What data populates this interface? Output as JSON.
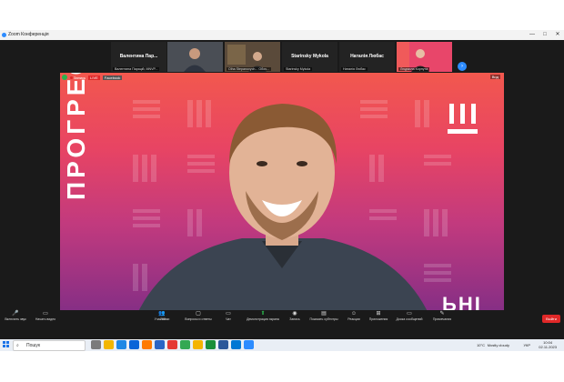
{
  "window": {
    "title": "Zoom Конференція",
    "controls": [
      "—",
      "□",
      "✕"
    ]
  },
  "participants": [
    {
      "big_name": "Валентина Пар...",
      "small_name": "Валентина Парацій, MNVP..."
    },
    {
      "big_name": "",
      "small_name": ""
    },
    {
      "big_name": "",
      "small_name": "Olha Stepanovych... Обоч..."
    },
    {
      "big_name": "Starinsky Mykola",
      "small_name": "Starinsky Mykola"
    },
    {
      "big_name": "Наталія Любас",
      "small_name": "Наталія Любас"
    },
    {
      "big_name": "",
      "small_name": "Людмила Корнута"
    }
  ],
  "main_video": {
    "speaker": "Dmytro Chumachenko",
    "vertical_text": "ПРОГРЕСИВНІ",
    "bottom_text": "ЬНІ",
    "rec_label": "Запись",
    "live_label": "LIVE",
    "stream_target": "Facebook",
    "view_label": "Вид"
  },
  "toolbar": {
    "audio": "Включить звук",
    "video": "Начать видео",
    "participants": "Участники",
    "participants_count": "260",
    "qa": "Вопросы и ответы",
    "chat": "Чат",
    "share": "Демонстрация экрана",
    "record": "Запись",
    "captions": "Показать субтитры",
    "reactions": "Реакции",
    "apps": "Приложения",
    "whiteboard": "Доска сообщений",
    "notes": "Примечания",
    "leave": "Выйти"
  },
  "taskbar": {
    "search_placeholder": "Пошук",
    "weather": "10°C",
    "condition": "Mostly cloudy",
    "lang": "УКР",
    "time": "10:04",
    "date": "02.11.2023"
  },
  "colors": {
    "zoom_blue": "#2d8cff",
    "leave_red": "#e02828",
    "share_green": "#2bb24c"
  }
}
